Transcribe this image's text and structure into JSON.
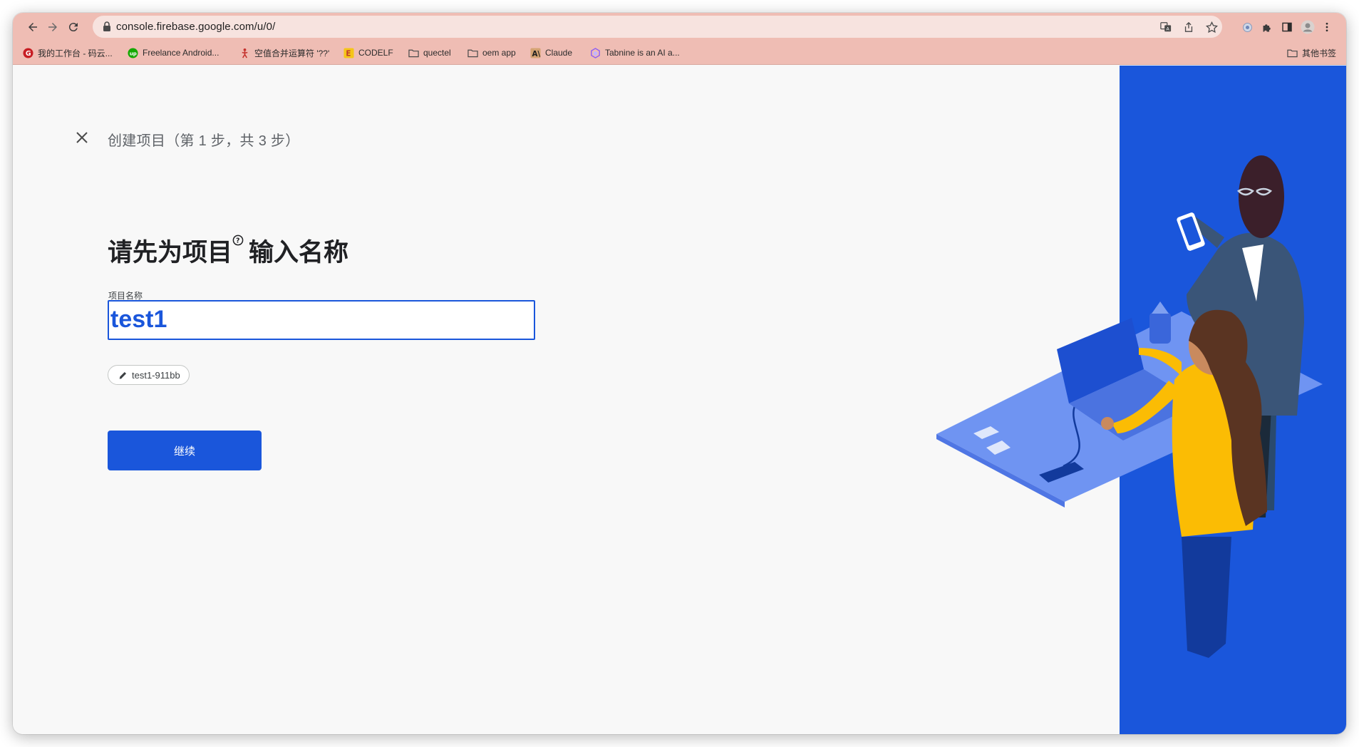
{
  "browser": {
    "url": "console.firebase.google.com/u/0/",
    "bookmarks": [
      {
        "label": "我的工作台 - 码云...",
        "icon": "gitee-icon"
      },
      {
        "label": "Freelance Android...",
        "icon": "upwork-icon"
      },
      {
        "label": "空值合并运算符 '??'",
        "icon": "figure-icon"
      },
      {
        "label": "CODELF",
        "icon": "codelf-icon"
      },
      {
        "label": "quectel",
        "icon": "folder-icon"
      },
      {
        "label": "oem app",
        "icon": "folder-icon"
      },
      {
        "label": "Claude",
        "icon": "anthropic-icon"
      },
      {
        "label": "Tabnine is an AI a...",
        "icon": "tabnine-icon"
      }
    ],
    "other_bookmarks": "其他书签"
  },
  "page": {
    "step_title": "创建项目（第 1 步，共 3 步）",
    "heading_part1": "请先为项目",
    "heading_part2": "输入名称",
    "field_label": "项目名称",
    "project_name_value": "test1",
    "project_id": "test1-911bb",
    "continue_label": "继续"
  },
  "colors": {
    "accent": "#1a56db",
    "toolbar": "#efbdb4",
    "background": "#f8f8f8"
  }
}
